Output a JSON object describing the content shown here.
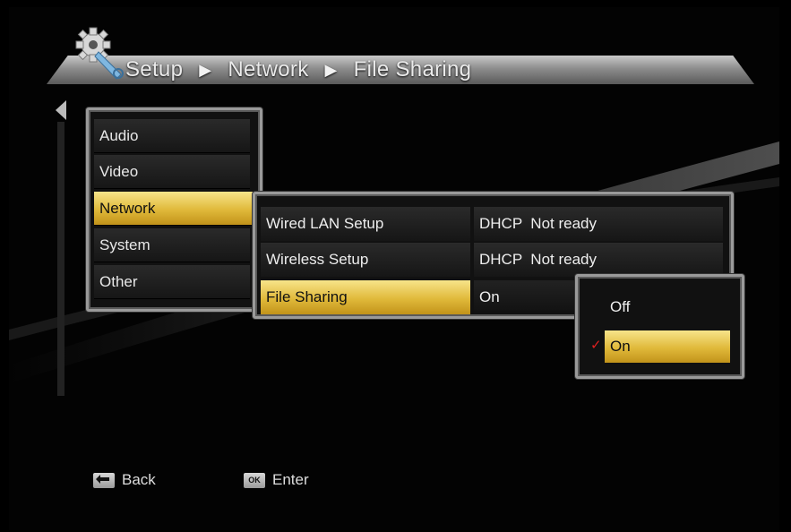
{
  "breadcrumb": {
    "items": [
      "Setup",
      "Network",
      "File Sharing"
    ],
    "separator_icon": "play-triangle-icon"
  },
  "main_menu": {
    "items": [
      {
        "label": "Audio"
      },
      {
        "label": "Video"
      },
      {
        "label": "Network",
        "selected": true
      },
      {
        "label": "System"
      },
      {
        "label": "Other"
      }
    ]
  },
  "network_menu": {
    "rows": [
      {
        "label": "Wired LAN Setup",
        "value": "DHCP  Not ready"
      },
      {
        "label": "Wireless Setup",
        "value": "DHCP  Not ready"
      },
      {
        "label": "File Sharing",
        "value": "On",
        "selected": true
      }
    ]
  },
  "option_popup": {
    "options": [
      {
        "label": "Off",
        "checked": false
      },
      {
        "label": "On",
        "checked": true,
        "highlighted": true
      }
    ],
    "check_icon": "checkmark-icon"
  },
  "footer": {
    "back_label": "Back",
    "back_key": "back-arrow-icon",
    "enter_key_label": "OK",
    "enter_label": "Enter"
  },
  "colors": {
    "highlight": "#e0b93a",
    "check": "#e02020",
    "panel_border": "#9a9a9a"
  }
}
